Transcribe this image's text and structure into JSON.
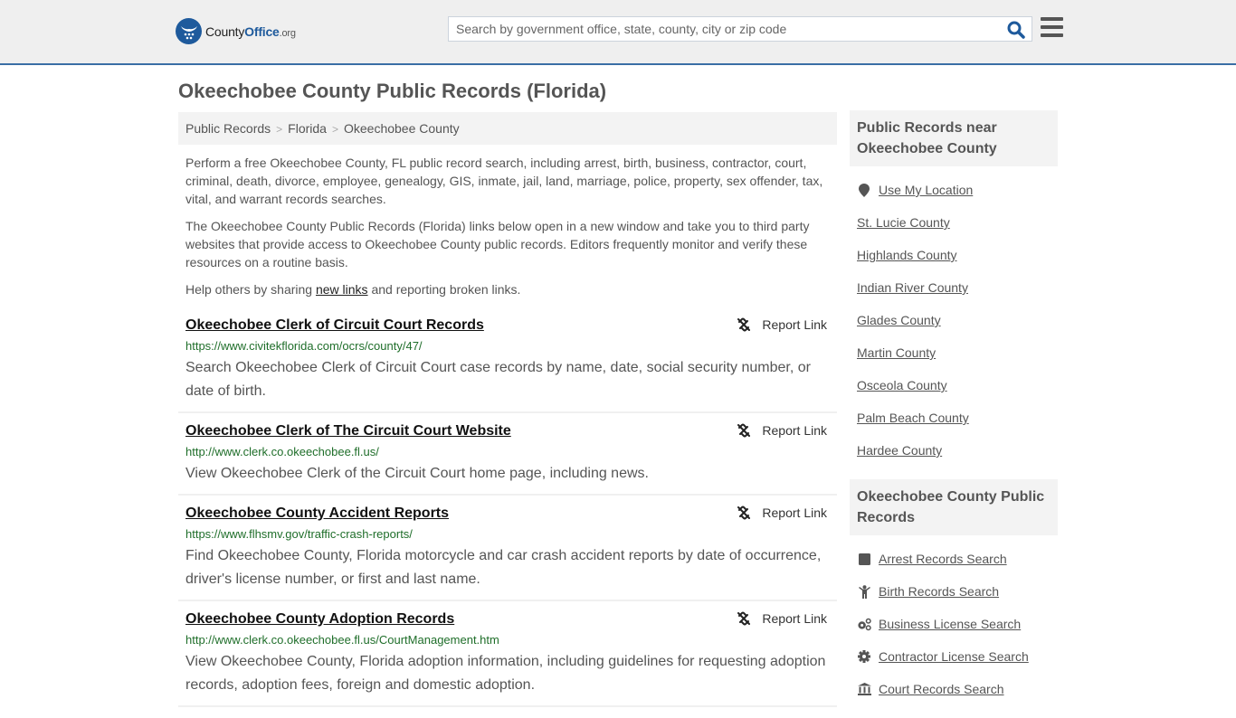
{
  "header": {
    "logo": {
      "name_part1": "County",
      "name_part2": "Office",
      "name_suffix": ".org"
    },
    "search": {
      "placeholder": "Search by government office, state, county, city or zip code",
      "value": ""
    },
    "colors": {
      "brand": "#1e5a9c",
      "topbar_bg": "#efefef",
      "topbar_border": "#3a6ea5"
    }
  },
  "page": {
    "title": "Okeechobee County Public Records (Florida)",
    "breadcrumb": [
      {
        "label": "Public Records"
      },
      {
        "label": "Florida"
      },
      {
        "label": "Okeechobee County"
      }
    ],
    "breadcrumb_separator": ">",
    "intro": {
      "p1": "Perform a free Okeechobee County, FL public record search, including arrest, birth, business, contractor, court, criminal, death, divorce, employee, genealogy, GIS, inmate, jail, land, marriage, police, property, sex offender, tax, vital, and warrant records searches.",
      "p2": "The Okeechobee County Public Records (Florida) links below open in a new window and take you to third party websites that provide access to Okeechobee County public records. Editors frequently monitor and verify these resources on a routine basis.",
      "p3_before": "Help others by sharing ",
      "p3_link": "new links",
      "p3_after": " and reporting broken links."
    }
  },
  "records": [
    {
      "title": "Okeechobee Clerk of Circuit Court Records",
      "url": "https://www.civitekflorida.com/ocrs/county/47/",
      "description": "Search Okeechobee Clerk of Circuit Court case records by name, date, social security number, or date of birth.",
      "report_label": "Report Link"
    },
    {
      "title": "Okeechobee Clerk of The Circuit Court Website",
      "url": "http://www.clerk.co.okeechobee.fl.us/",
      "description": "View Okeechobee Clerk of the Circuit Court home page, including news.",
      "report_label": "Report Link"
    },
    {
      "title": "Okeechobee County Accident Reports",
      "url": "https://www.flhsmv.gov/traffic-crash-reports/",
      "description": "Find Okeechobee County, Florida motorcycle and car crash accident reports by date of occurrence, driver's license number, or first and last name.",
      "report_label": "Report Link"
    },
    {
      "title": "Okeechobee County Adoption Records",
      "url": "http://www.clerk.co.okeechobee.fl.us/CourtManagement.htm",
      "description": "View Okeechobee County, Florida adoption information, including guidelines for requesting adoption records, adoption fees, foreign and domestic adoption.",
      "report_label": "Report Link"
    }
  ],
  "sidebar": {
    "nearby": {
      "heading": "Public Records near Okeechobee County",
      "use_location": {
        "label": "Use My Location",
        "icon": "map-marker-icon"
      },
      "counties": [
        "St. Lucie County",
        "Highlands County",
        "Indian River County",
        "Glades County",
        "Martin County",
        "Osceola County",
        "Palm Beach County",
        "Hardee County"
      ]
    },
    "county_records": {
      "heading": "Okeechobee County Public Records",
      "items": [
        {
          "label": "Arrest Records Search",
          "icon": "square-icon"
        },
        {
          "label": "Birth Records Search",
          "icon": "child-icon"
        },
        {
          "label": "Business License Search",
          "icon": "cogs-icon"
        },
        {
          "label": "Contractor License Search",
          "icon": "cog-icon"
        },
        {
          "label": "Court Records Search",
          "icon": "courthouse-icon"
        }
      ]
    }
  }
}
